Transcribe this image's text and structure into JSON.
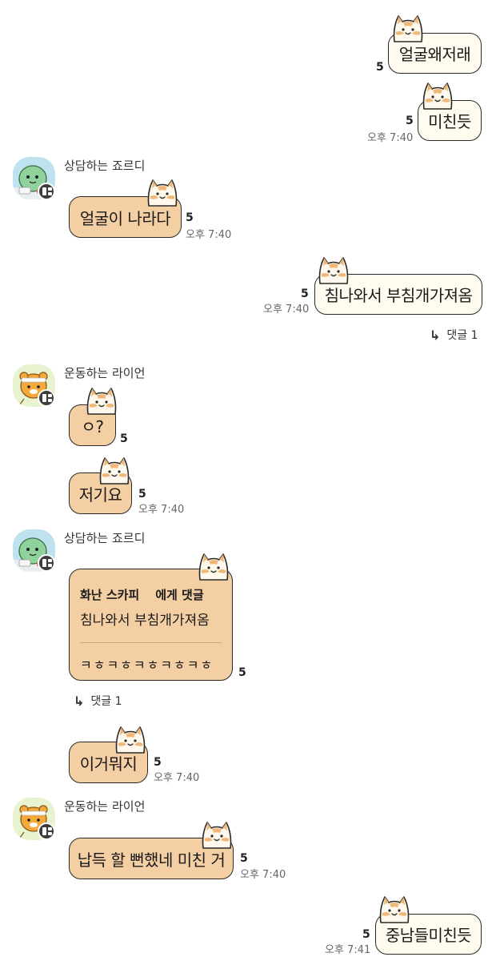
{
  "chat": {
    "unread_count": "5",
    "reply_label": "댓글 1",
    "senders": {
      "jordy": "상담하는 죠르디",
      "ryan": "운동하는 라이언"
    },
    "messages": [
      {
        "text": "얼굴왜저래",
        "side": "mine"
      },
      {
        "text": "미친듯",
        "side": "mine",
        "time": "오후 7:40"
      },
      {
        "text": "얼굴이 나라다",
        "side": "theirs",
        "time": "오후 7:40"
      },
      {
        "text": "침나와서 부침개가져옴",
        "side": "mine",
        "time": "오후 7:40"
      },
      {
        "text": "ㅇ?",
        "side": "theirs"
      },
      {
        "text": "저기요",
        "side": "theirs",
        "time": "오후 7:40"
      },
      {
        "text": "이거뭐지",
        "side": "theirs",
        "time": "오후 7:40"
      },
      {
        "text": "납득 할 뻔했네 미친 거",
        "side": "theirs",
        "time": "오후 7:40"
      },
      {
        "text": "중남들미친듯",
        "side": "mine",
        "time": "오후 7:41"
      }
    ],
    "quote": {
      "target_name": "화난 스카피",
      "target_suffix": "에게 댓글",
      "quoted_text": "침나와서 부침개가져옴",
      "reply_text": "ㅋㅎㅋㅎㅋㅎㅋㅎㅋㅎ"
    }
  },
  "icons": {
    "sticker": "cat-sticker-icon",
    "reply_arrow": "reply-arrow-icon",
    "profile_badge": "grid-badge-icon"
  },
  "colors": {
    "my_bubble": "#fffbee",
    "their_bubble": "#f3cfa3",
    "outline": "#2a2a2a",
    "time_text": "#666666"
  }
}
